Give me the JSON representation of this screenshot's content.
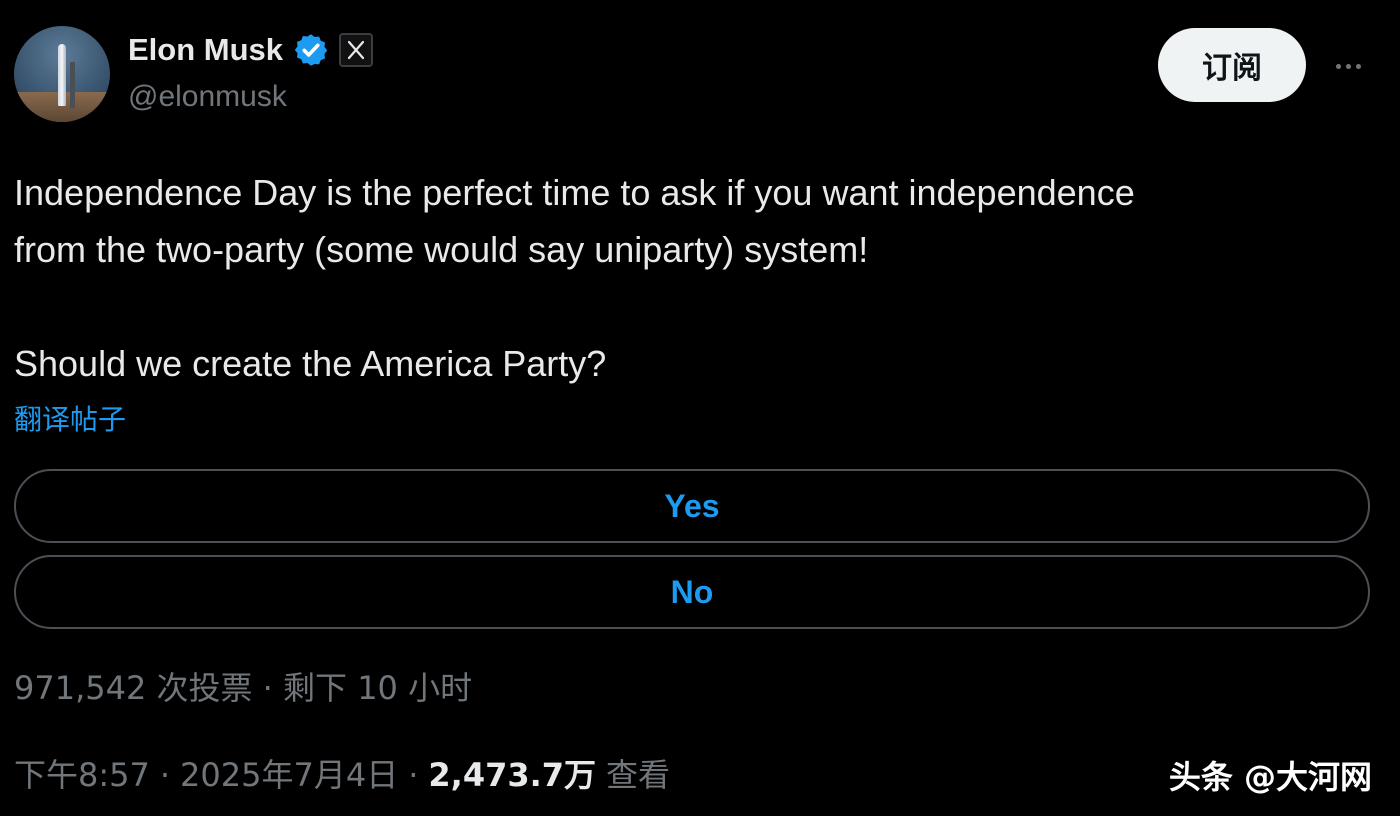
{
  "author": {
    "display_name": "Elon Musk",
    "handle": "@elonmusk",
    "verified_icon": "verified-badge-icon",
    "affiliation_icon": "x-logo-icon"
  },
  "header": {
    "subscribe_label": "订阅",
    "more_icon": "more-options-icon"
  },
  "tweet": {
    "line1": "Independence Day is the perfect time to ask if you want independence",
    "line2": "from the two-party (some would say uniparty) system!",
    "question": "Should we create the America Party?",
    "translate_link": "翻译帖子"
  },
  "poll": {
    "options": [
      {
        "label": "Yes"
      },
      {
        "label": "No"
      }
    ],
    "meta": "971,542 次投票 · 剩下 10 小时"
  },
  "footer": {
    "time": "下午8:57",
    "date": "2025年7月4日",
    "separator": "·",
    "views_count": "2,473.7万",
    "views_label": "查看"
  },
  "watermark": "头条 @大河网",
  "colors": {
    "background": "#000000",
    "text": "#e7e9ea",
    "muted": "#71767b",
    "accent": "#1d9bf0",
    "border": "#4b5056"
  }
}
